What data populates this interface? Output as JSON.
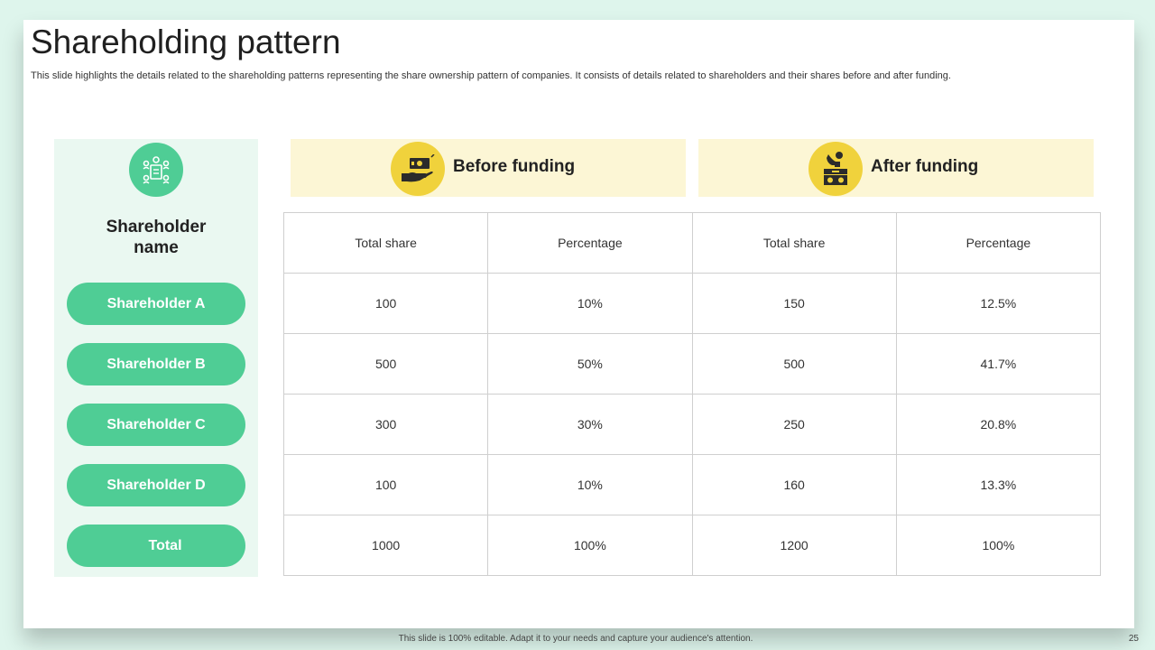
{
  "slide": {
    "title": "Shareholding pattern",
    "subtitle": "This slide highlights the details related to the shareholding patterns representing the share ownership pattern of companies. It consists of details related to shareholders and their shares before and after funding."
  },
  "left_panel": {
    "icon": "shareholder-group-icon",
    "heading_line1": "Shareholder",
    "heading_line2": "name",
    "rows": [
      "Shareholder A",
      "Shareholder B",
      "Shareholder C",
      "Shareholder D",
      "Total"
    ]
  },
  "groups": {
    "before": {
      "label": "Before funding",
      "icon": "cash-hand-icon"
    },
    "after": {
      "label": "After funding",
      "icon": "coin-box-icon"
    }
  },
  "table": {
    "headers": [
      "Total share",
      "Percentage",
      "Total share",
      "Percentage"
    ],
    "rows": [
      [
        "100",
        "10%",
        "150",
        "12.5%"
      ],
      [
        "500",
        "50%",
        "500",
        "41.7%"
      ],
      [
        "300",
        "30%",
        "250",
        "20.8%"
      ],
      [
        "100",
        "10%",
        "160",
        "13.3%"
      ],
      [
        "1000",
        "100%",
        "1200",
        "100%"
      ]
    ]
  },
  "footer": {
    "note": "This slide is 100% editable. Adapt it to your needs and capture your audience's attention.",
    "page_number": "25"
  },
  "colors": {
    "accent_green": "#4fcd95",
    "panel_green": "#eaf8f1",
    "accent_yellow": "#f0d23c",
    "panel_yellow": "#fcf6d5",
    "background": "#def5ec"
  }
}
